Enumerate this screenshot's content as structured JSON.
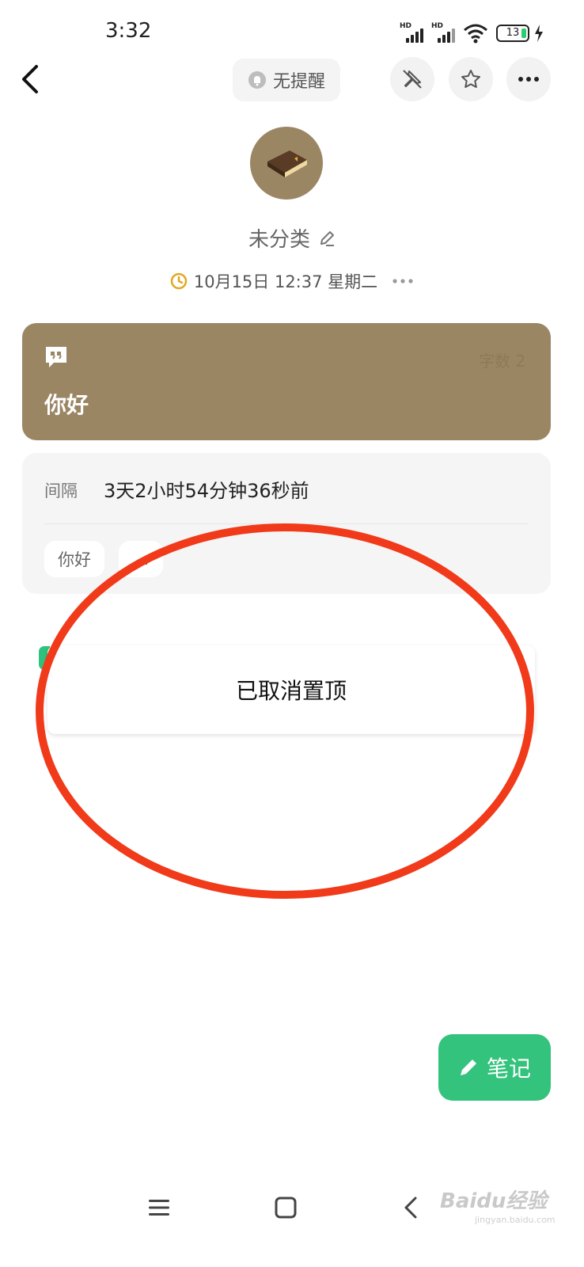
{
  "status_bar": {
    "time": "3:32",
    "signal_label": "HD",
    "battery": "13"
  },
  "top_bar": {
    "reminder_label": "无提醒"
  },
  "category": {
    "name": "未分类",
    "datetime": "10月15日 12:37 星期二"
  },
  "note": {
    "word_count": "字数 2",
    "text": "你好",
    "card_color": "#9b8664"
  },
  "info": {
    "interval_label": "间隔",
    "interval_value": "3天2小时54分钟36秒前",
    "tags": [
      "你好",
      "…"
    ]
  },
  "toast": {
    "message": "已取消置顶"
  },
  "fab": {
    "label": "笔记",
    "color": "#33c37c"
  },
  "watermark": {
    "text": "Baidu经验",
    "sub": "jingyan.baidu.com"
  },
  "annotation_color": "#f03a1a"
}
